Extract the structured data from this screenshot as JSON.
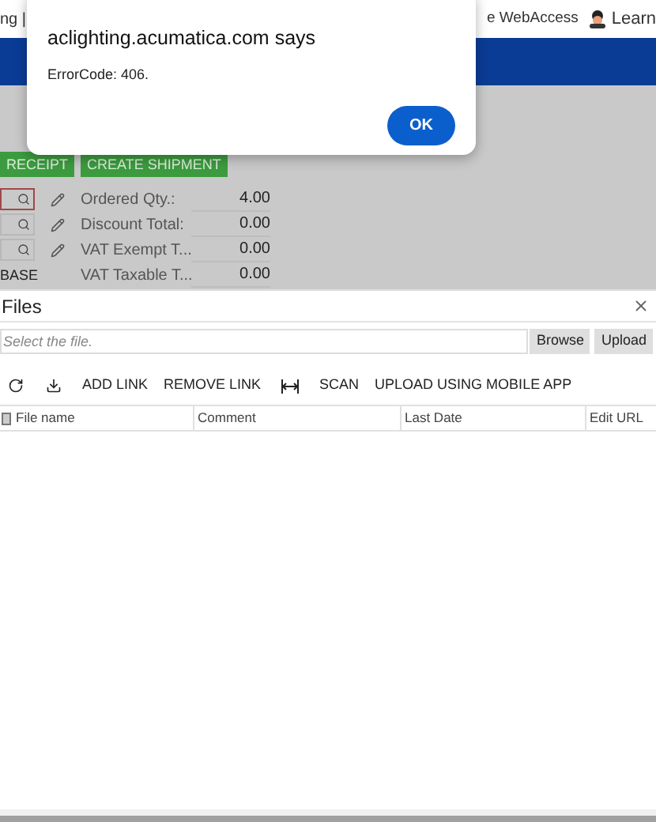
{
  "browser_bar": {
    "left_text": "ng |",
    "webaccess_link": "e WebAccess",
    "learn_link": "Learn"
  },
  "dialog": {
    "title": "aclighting.acumatica.com says",
    "message": "ErrorCode: 406.",
    "button": "OK"
  },
  "action_buttons": [
    "RECEIPT",
    "CREATE SHIPMENT"
  ],
  "left_fields": [
    {
      "kind": "lookup",
      "invalid": true
    },
    {
      "kind": "lookup",
      "invalid": false
    },
    {
      "kind": "lookup",
      "invalid": false
    },
    {
      "kind": "text",
      "value": "BASE"
    }
  ],
  "summary": [
    {
      "label": "Ordered Qty.:",
      "value": "4.00"
    },
    {
      "label": "Discount Total:",
      "value": "0.00"
    },
    {
      "label": "VAT Exempt T...",
      "value": "0.00"
    },
    {
      "label": "VAT Taxable T...",
      "value": "0.00"
    }
  ],
  "files_panel": {
    "title": "Files",
    "file_field": {
      "placeholder": "Select the file."
    },
    "browse_button": "Browse",
    "upload_button": "Upload",
    "toolbar": [
      {
        "kind": "refresh"
      },
      {
        "kind": "download"
      },
      {
        "kind": "text",
        "label": "ADD LINK"
      },
      {
        "kind": "text",
        "label": "REMOVE LINK"
      },
      {
        "kind": "fit"
      },
      {
        "kind": "text",
        "label": "SCAN"
      },
      {
        "kind": "text",
        "label": "UPLOAD USING MOBILE APP"
      }
    ],
    "columns": [
      "File name",
      "Comment",
      "Last Date",
      "Edit URL"
    ]
  }
}
